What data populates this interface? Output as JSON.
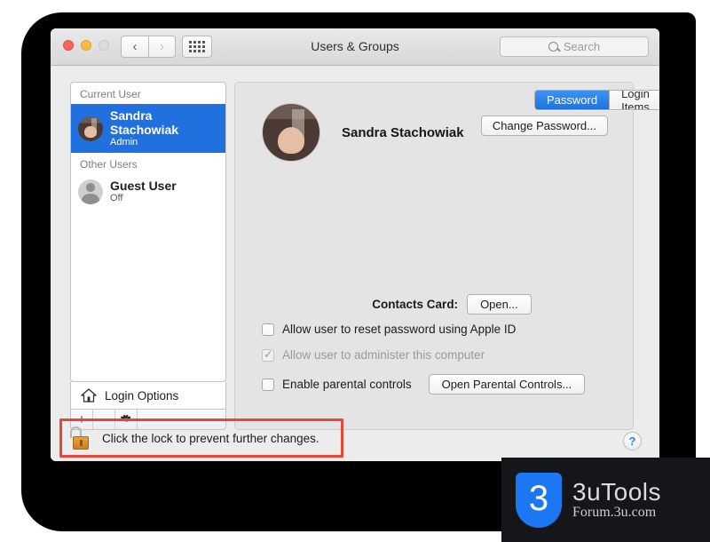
{
  "window": {
    "title": "Users & Groups",
    "traffic_lights": [
      "close",
      "minimize",
      "zoom"
    ],
    "nav": {
      "back": "‹",
      "forward": "›",
      "show_all": "grid-icon"
    },
    "search": {
      "placeholder": "Search",
      "value": ""
    }
  },
  "sidebar": {
    "groups": [
      {
        "header": "Current User",
        "users": [
          {
            "name": "Sandra Stachowiak",
            "status": "Admin",
            "selected": true,
            "avatar": "photo"
          }
        ]
      },
      {
        "header": "Other Users",
        "users": [
          {
            "name": "Guest User",
            "status": "Off",
            "selected": false,
            "avatar": "silhouette"
          }
        ]
      }
    ],
    "login_options": "Login Options",
    "toolbar": {
      "add": "+",
      "remove": "−",
      "settings": "gear-icon"
    }
  },
  "panel": {
    "tabs": [
      {
        "label": "Password",
        "active": true
      },
      {
        "label": "Login Items",
        "active": false
      }
    ],
    "account": {
      "full_name": "Sandra Stachowiak",
      "change_password_button": "Change Password..."
    },
    "contacts": {
      "label": "Contacts Card:",
      "open_button": "Open..."
    },
    "options": [
      {
        "label": "Allow user to reset password using Apple ID",
        "checked": false,
        "disabled": false
      },
      {
        "label": "Allow user to administer this computer",
        "checked": true,
        "disabled": true
      },
      {
        "label": "Enable parental controls",
        "checked": false,
        "disabled": false
      }
    ],
    "parental_controls_button": "Open Parental Controls...",
    "help_button": "?"
  },
  "lock": {
    "icon": "unlocked-padlock-icon",
    "message": "Click the lock to prevent further changes."
  },
  "annotation": {
    "highlight_color": "#e8463c"
  },
  "watermark": {
    "logo_char": "3",
    "name": "3uTools",
    "subtitle": "Forum.3u.com",
    "brand_color": "#1b78f2"
  }
}
